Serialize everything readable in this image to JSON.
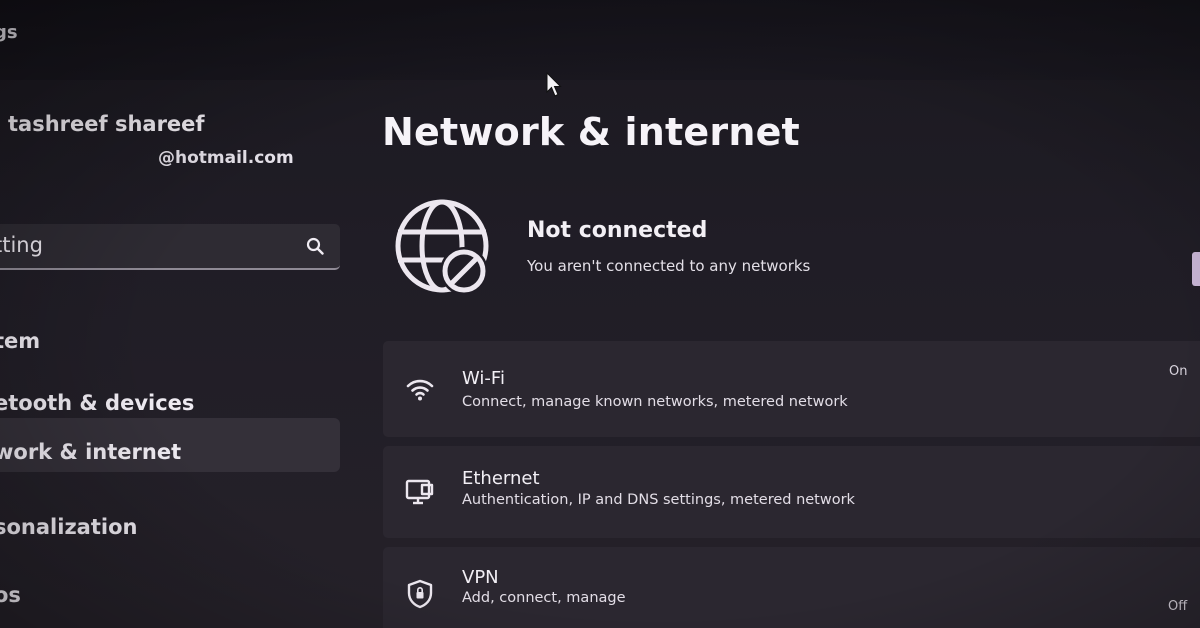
{
  "window": {
    "title": "gs"
  },
  "sidebar": {
    "profile": {
      "name": "tashreef shareef",
      "email": "@hotmail.com"
    },
    "search": {
      "value": "tting"
    },
    "items": [
      {
        "label": "tem"
      },
      {
        "label": "etooth & devices"
      },
      {
        "label": "work & internet",
        "selected": true
      },
      {
        "label": "sonalization"
      },
      {
        "label": "os"
      }
    ]
  },
  "main": {
    "title": "Network & internet",
    "status": {
      "icon": "globe-blocked-icon",
      "title": "Not connected",
      "subtitle": "You aren't connected to any networks"
    },
    "cards": [
      {
        "icon": "wifi-icon",
        "title": "Wi-Fi",
        "description": "Connect, manage known networks, metered network",
        "toggle": "On"
      },
      {
        "icon": "ethernet-icon",
        "title": "Ethernet",
        "description": "Authentication, IP and DNS settings, metered network"
      },
      {
        "icon": "shield-icon",
        "title": "VPN",
        "description": "Add, connect, manage",
        "toggle": "Off"
      }
    ]
  },
  "colors": {
    "background": "#201d26",
    "card": "#2b2730",
    "selected_nav": "#343039",
    "accent": "#c9b6d6"
  }
}
